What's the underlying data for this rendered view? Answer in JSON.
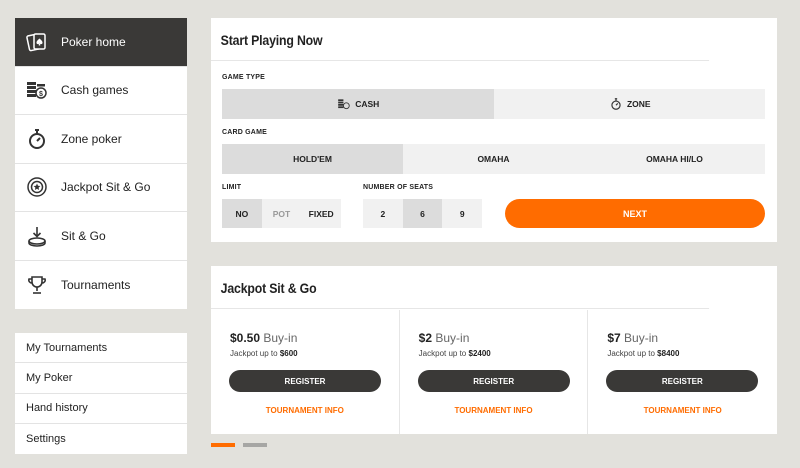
{
  "nav": {
    "items": [
      {
        "label": "Poker home",
        "icon": "poker-cards-icon",
        "active": true
      },
      {
        "label": "Cash games",
        "icon": "cash-stack-icon"
      },
      {
        "label": "Zone poker",
        "icon": "stopwatch-icon"
      },
      {
        "label": "Jackpot Sit & Go",
        "icon": "jackpot-chip-icon"
      },
      {
        "label": "Sit & Go",
        "icon": "sit-go-stack-icon"
      },
      {
        "label": "Tournaments",
        "icon": "trophy-icon"
      }
    ]
  },
  "subnav": {
    "items": [
      "My Tournaments",
      "My Poker",
      "Hand history",
      "Settings"
    ]
  },
  "start": {
    "title": "Start Playing Now",
    "game_type_label": "GAME TYPE",
    "game_type": {
      "cash": "CASH",
      "zone": "ZONE"
    },
    "card_game_label": "CARD GAME",
    "card_game": {
      "holdem": "HOLD'EM",
      "omaha": "OMAHA",
      "omaha_hilo": "OMAHA HI/LO"
    },
    "limit_label": "LIMIT",
    "limit": {
      "no": "NO",
      "pot": "POT",
      "fixed": "FIXED"
    },
    "seats_label": "NUMBER OF SEATS",
    "seats": {
      "two": "2",
      "six": "6",
      "nine": "9"
    },
    "next_label": "NEXT"
  },
  "jackpot": {
    "title": "Jackpot Sit & Go",
    "cards": [
      {
        "amount": "$0.50",
        "buyin": "Buy-in",
        "jackpot_prefix": "Jackpot up to",
        "jackpot_amount": "$600",
        "register": "REGISTER",
        "info": "TOURNAMENT INFO"
      },
      {
        "amount": "$2",
        "buyin": "Buy-in",
        "jackpot_prefix": "Jackpot up to",
        "jackpot_amount": "$2400",
        "register": "REGISTER",
        "info": "TOURNAMENT INFO"
      },
      {
        "amount": "$7",
        "buyin": "Buy-in",
        "jackpot_prefix": "Jackpot up to",
        "jackpot_amount": "$8400",
        "register": "REGISTER",
        "info": "TOURNAMENT INFO"
      }
    ]
  },
  "colors": {
    "accent": "#ff6c00",
    "dark": "#3a3937",
    "background": "#e2e1dc"
  }
}
